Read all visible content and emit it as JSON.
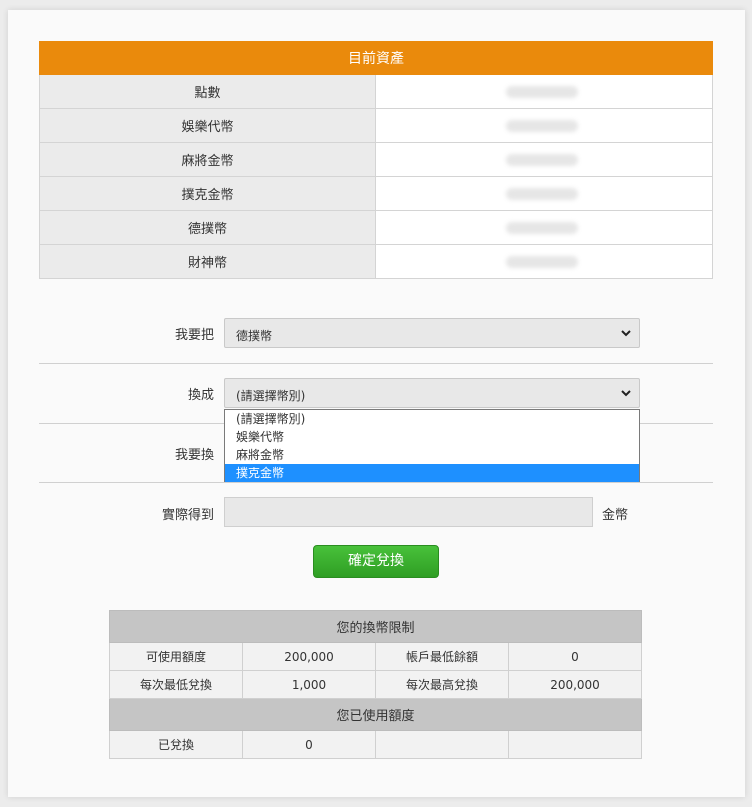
{
  "assets": {
    "title": "目前資產",
    "rows": [
      {
        "label": "點數"
      },
      {
        "label": "娛樂代幣"
      },
      {
        "label": "麻將金幣"
      },
      {
        "label": "撲克金幣"
      },
      {
        "label": "德撲幣"
      },
      {
        "label": "財神幣"
      }
    ]
  },
  "form": {
    "from_label": "我要把",
    "from_value": "德撲幣",
    "to_label": "換成",
    "to_value": "(請選擇幣別)",
    "amount_label": "我要換",
    "actual_label": "實際得到",
    "actual_unit": "金幣",
    "dropdown_options": [
      "(請選擇幣別)",
      "娛樂代幣",
      "麻將金幣",
      "撲克金幣"
    ],
    "dropdown_selected_index": 3,
    "submit_label": "確定兌換"
  },
  "limits": {
    "title": "您的換幣限制",
    "rows": [
      [
        "可使用額度",
        "200,000",
        "帳戶最低餘額",
        "0"
      ],
      [
        "每次最低兌換",
        "1,000",
        "每次最高兌換",
        "200,000"
      ]
    ],
    "used_title": "您已使用額度",
    "used_row": [
      "已兌換",
      "0",
      "",
      ""
    ]
  }
}
